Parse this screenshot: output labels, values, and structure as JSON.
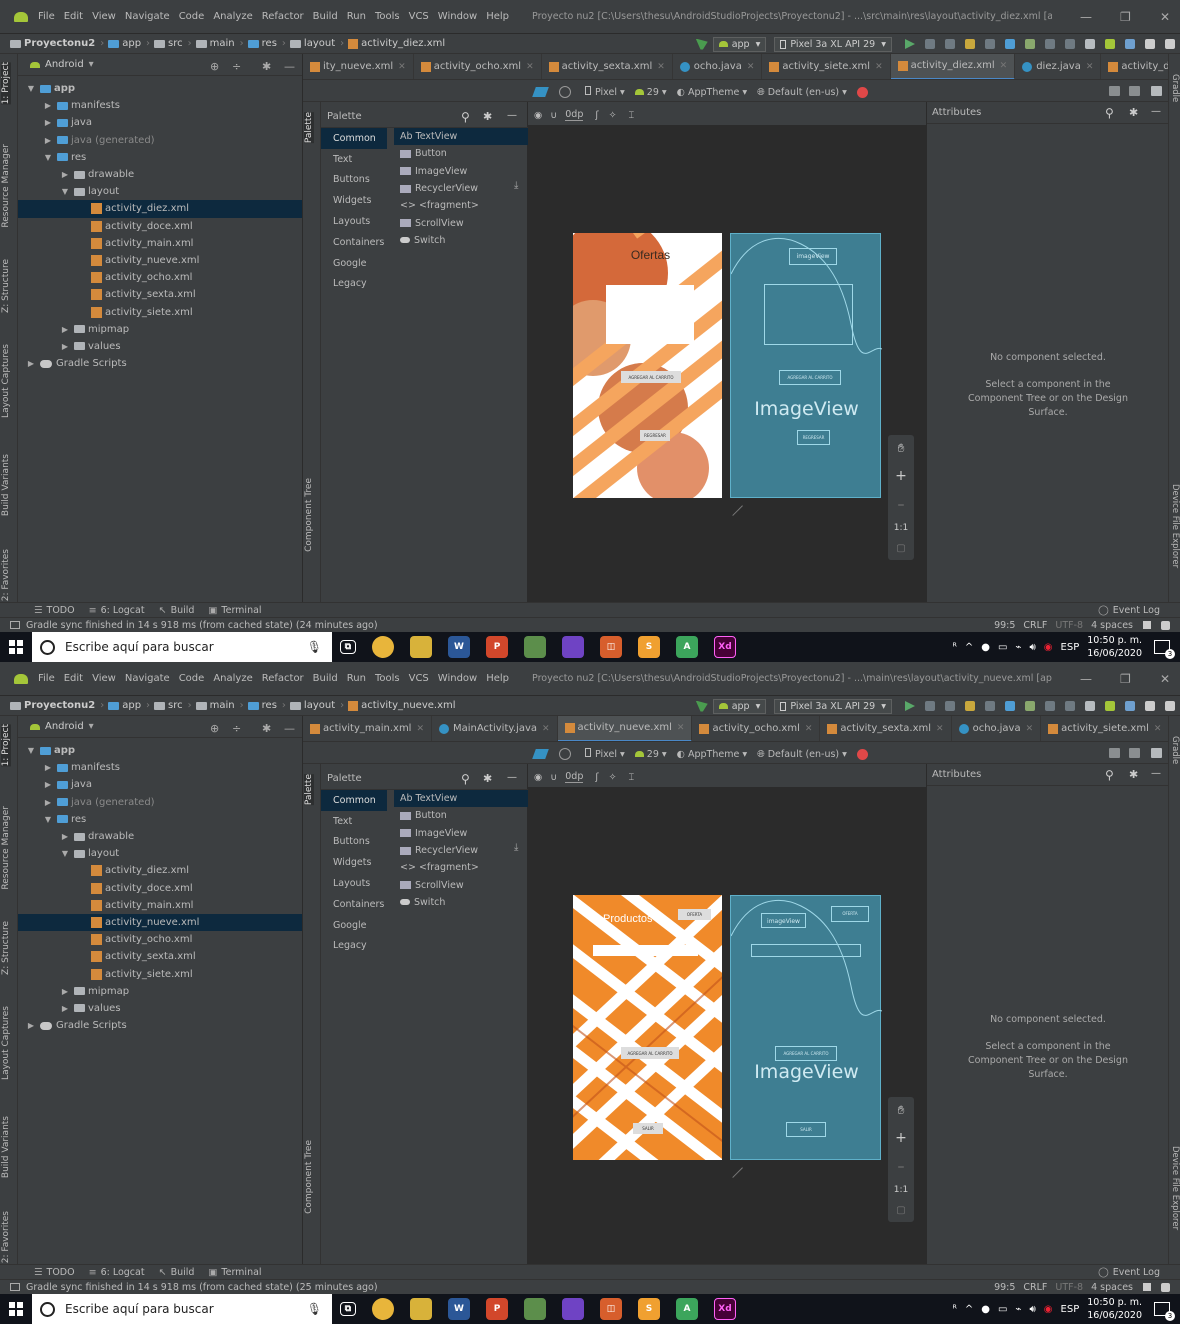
{
  "screens": [
    {
      "menu": [
        "File",
        "Edit",
        "View",
        "Navigate",
        "Code",
        "Analyze",
        "Refactor",
        "Build",
        "Run",
        "Tools",
        "VCS",
        "Window",
        "Help"
      ],
      "window_title": "Proyecto nu2 [C:\\Users\\thesu\\AndroidStudioProjects\\Proyectonu2] - ...\\src\\main\\res\\layout\\activity_diez.xml [app]",
      "breadcrumb": [
        "Proyectonu2",
        "app",
        "src",
        "main",
        "res",
        "layout",
        "activity_diez.xml"
      ],
      "run_config": "app",
      "device": "Pixel 3a XL API 29",
      "project_view": "Android",
      "tabs": [
        {
          "label": "ity_nueve.xml",
          "type": "xml"
        },
        {
          "label": "activity_ocho.xml",
          "type": "xml"
        },
        {
          "label": "activity_sexta.xml",
          "type": "xml"
        },
        {
          "label": "ocho.java",
          "type": "java"
        },
        {
          "label": "activity_siete.xml",
          "type": "xml"
        },
        {
          "label": "activity_diez.xml",
          "type": "xml",
          "active": true
        },
        {
          "label": "diez.java",
          "type": "java"
        },
        {
          "label": "activity_doce.xm",
          "type": "xml"
        }
      ],
      "tree": [
        {
          "label": "app",
          "depth": 0,
          "arrow": "down",
          "icon": "module"
        },
        {
          "label": "manifests",
          "depth": 1,
          "arrow": "right",
          "icon": "folder"
        },
        {
          "label": "java",
          "depth": 1,
          "arrow": "right",
          "icon": "folder"
        },
        {
          "label": "java (generated)",
          "depth": 1,
          "arrow": "right",
          "icon": "folder"
        },
        {
          "label": "res",
          "depth": 1,
          "arrow": "down",
          "icon": "folder"
        },
        {
          "label": "drawable",
          "depth": 2,
          "arrow": "right",
          "icon": "folder"
        },
        {
          "label": "layout",
          "depth": 2,
          "arrow": "down",
          "icon": "folder"
        },
        {
          "label": "activity_diez.xml",
          "depth": 3,
          "icon": "xml",
          "selected": true
        },
        {
          "label": "activity_doce.xml",
          "depth": 3,
          "icon": "xml"
        },
        {
          "label": "activity_main.xml",
          "depth": 3,
          "icon": "xml"
        },
        {
          "label": "activity_nueve.xml",
          "depth": 3,
          "icon": "xml"
        },
        {
          "label": "activity_ocho.xml",
          "depth": 3,
          "icon": "xml"
        },
        {
          "label": "activity_sexta.xml",
          "depth": 3,
          "icon": "xml"
        },
        {
          "label": "activity_siete.xml",
          "depth": 3,
          "icon": "xml"
        },
        {
          "label": "mipmap",
          "depth": 2,
          "arrow": "right",
          "icon": "folder"
        },
        {
          "label": "values",
          "depth": 2,
          "arrow": "right",
          "icon": "folder"
        },
        {
          "label": "Gradle Scripts",
          "depth": 0,
          "arrow": "right",
          "icon": "gradle"
        }
      ],
      "palette_title": "Palette",
      "palette_categories": [
        "Common",
        "Text",
        "Buttons",
        "Widgets",
        "Layouts",
        "Containers",
        "Google",
        "Legacy"
      ],
      "palette_widgets": [
        "Ab TextView",
        "Button",
        "ImageView",
        "RecyclerView",
        "<> <fragment>",
        "ScrollView",
        "Switch"
      ],
      "design_toolbar": {
        "device": "Pixel",
        "api": "29",
        "theme": "AppTheme",
        "locale": "Default (en-us)",
        "margin": "0dp"
      },
      "attributes_title": "Attributes",
      "no_selection": "No component selected.",
      "no_selection_hint": "Select a component in the Component Tree or on the Design Surface.",
      "zoom_label": "1:1",
      "design_preview": {
        "title": "Ofertas",
        "button1": "AGREGAR AL CARRITO",
        "button2": "REGRESAR"
      },
      "blueprint": {
        "image_label": "ImageView",
        "small_image": "imageView",
        "btn1": "AGREGAR AL CARRITO",
        "btn2": "REGRESAR"
      },
      "bottom_tabs": [
        "TODO",
        "6: Logcat",
        "Build",
        "Terminal"
      ],
      "event_log": "Event Log",
      "status_text": "Gradle sync finished in 14 s 918 ms (from cached state) (24 minutes ago)",
      "status_right": [
        "99:5",
        "CRLF",
        "UTF-8",
        "4 spaces"
      ],
      "left_tool_tabs": [
        "1: Project",
        "Resource Manager",
        "Z: Structure",
        "Layout Captures",
        "Build Variants",
        "2: Favorites"
      ],
      "right_tool_tabs": [
        "Gradle",
        "Device File Explorer"
      ],
      "side_tabs": [
        "Palette",
        "Component Tree"
      ],
      "taskbar": {
        "search_placeholder": "Escribe aquí para buscar",
        "lang": "ESP",
        "time": "10:50 p. m.",
        "date": "16/06/2020",
        "notif": "3"
      }
    },
    {
      "menu": [
        "File",
        "Edit",
        "View",
        "Navigate",
        "Code",
        "Analyze",
        "Refactor",
        "Build",
        "Run",
        "Tools",
        "VCS",
        "Window",
        "Help"
      ],
      "window_title": "Proyecto nu2 [C:\\Users\\thesu\\AndroidStudioProjects\\Proyectonu2] - ...\\main\\res\\layout\\activity_nueve.xml [app]",
      "breadcrumb": [
        "Proyectonu2",
        "app",
        "src",
        "main",
        "res",
        "layout",
        "activity_nueve.xml"
      ],
      "run_config": "app",
      "device": "Pixel 3a XL API 29",
      "project_view": "Android",
      "tabs": [
        {
          "label": "activity_main.xml",
          "type": "xml"
        },
        {
          "label": "MainActivity.java",
          "type": "java"
        },
        {
          "label": "activity_nueve.xml",
          "type": "xml",
          "active": true
        },
        {
          "label": "activity_ocho.xml",
          "type": "xml"
        },
        {
          "label": "activity_sexta.xml",
          "type": "xml"
        },
        {
          "label": "ocho.java",
          "type": "java"
        },
        {
          "label": "activity_siete.xml",
          "type": "xml"
        }
      ],
      "tree": [
        {
          "label": "app",
          "depth": 0,
          "arrow": "down",
          "icon": "module"
        },
        {
          "label": "manifests",
          "depth": 1,
          "arrow": "right",
          "icon": "folder"
        },
        {
          "label": "java",
          "depth": 1,
          "arrow": "right",
          "icon": "folder"
        },
        {
          "label": "java (generated)",
          "depth": 1,
          "arrow": "right",
          "icon": "folder"
        },
        {
          "label": "res",
          "depth": 1,
          "arrow": "down",
          "icon": "folder"
        },
        {
          "label": "drawable",
          "depth": 2,
          "arrow": "right",
          "icon": "folder"
        },
        {
          "label": "layout",
          "depth": 2,
          "arrow": "down",
          "icon": "folder"
        },
        {
          "label": "activity_diez.xml",
          "depth": 3,
          "icon": "xml"
        },
        {
          "label": "activity_doce.xml",
          "depth": 3,
          "icon": "xml"
        },
        {
          "label": "activity_main.xml",
          "depth": 3,
          "icon": "xml"
        },
        {
          "label": "activity_nueve.xml",
          "depth": 3,
          "icon": "xml",
          "selected": true
        },
        {
          "label": "activity_ocho.xml",
          "depth": 3,
          "icon": "xml"
        },
        {
          "label": "activity_sexta.xml",
          "depth": 3,
          "icon": "xml"
        },
        {
          "label": "activity_siete.xml",
          "depth": 3,
          "icon": "xml"
        },
        {
          "label": "mipmap",
          "depth": 2,
          "arrow": "right",
          "icon": "folder"
        },
        {
          "label": "values",
          "depth": 2,
          "arrow": "right",
          "icon": "folder"
        },
        {
          "label": "Gradle Scripts",
          "depth": 0,
          "arrow": "right",
          "icon": "gradle"
        }
      ],
      "palette_title": "Palette",
      "palette_categories": [
        "Common",
        "Text",
        "Buttons",
        "Widgets",
        "Layouts",
        "Containers",
        "Google",
        "Legacy"
      ],
      "palette_widgets": [
        "Ab TextView",
        "Button",
        "ImageView",
        "RecyclerView",
        "<> <fragment>",
        "ScrollView",
        "Switch"
      ],
      "design_toolbar": {
        "device": "Pixel",
        "api": "29",
        "theme": "AppTheme",
        "locale": "Default (en-us)",
        "margin": "0dp"
      },
      "attributes_title": "Attributes",
      "no_selection": "No component selected.",
      "no_selection_hint": "Select a component in the Component Tree or on the Design Surface.",
      "zoom_label": "1:1",
      "design_preview": {
        "title": "Productos",
        "button1": "AGREGAR AL CARRITO",
        "button2": "SALIR",
        "button3": "OFERTA"
      },
      "blueprint": {
        "image_label": "ImageView",
        "small_image": "imageView",
        "btn1": "AGREGAR AL CARRITO",
        "btn2": "SALIR",
        "btn3": "OFERTA"
      },
      "bottom_tabs": [
        "TODO",
        "6: Logcat",
        "Build",
        "Terminal"
      ],
      "event_log": "Event Log",
      "status_text": "Gradle sync finished in 14 s 918 ms (from cached state) (25 minutes ago)",
      "status_right": [
        "99:5",
        "CRLF",
        "UTF-8",
        "4 spaces"
      ],
      "left_tool_tabs": [
        "1: Project",
        "Resource Manager",
        "Z: Structure",
        "Layout Captures",
        "Build Variants",
        "2: Favorites"
      ],
      "right_tool_tabs": [
        "Gradle",
        "Device File Explorer"
      ],
      "side_tabs": [
        "Palette",
        "Component Tree"
      ],
      "taskbar": {
        "search_placeholder": "Escribe aquí para buscar",
        "lang": "ESP",
        "time": "10:50 p. m.",
        "date": "16/06/2020",
        "notif": "3"
      }
    }
  ]
}
